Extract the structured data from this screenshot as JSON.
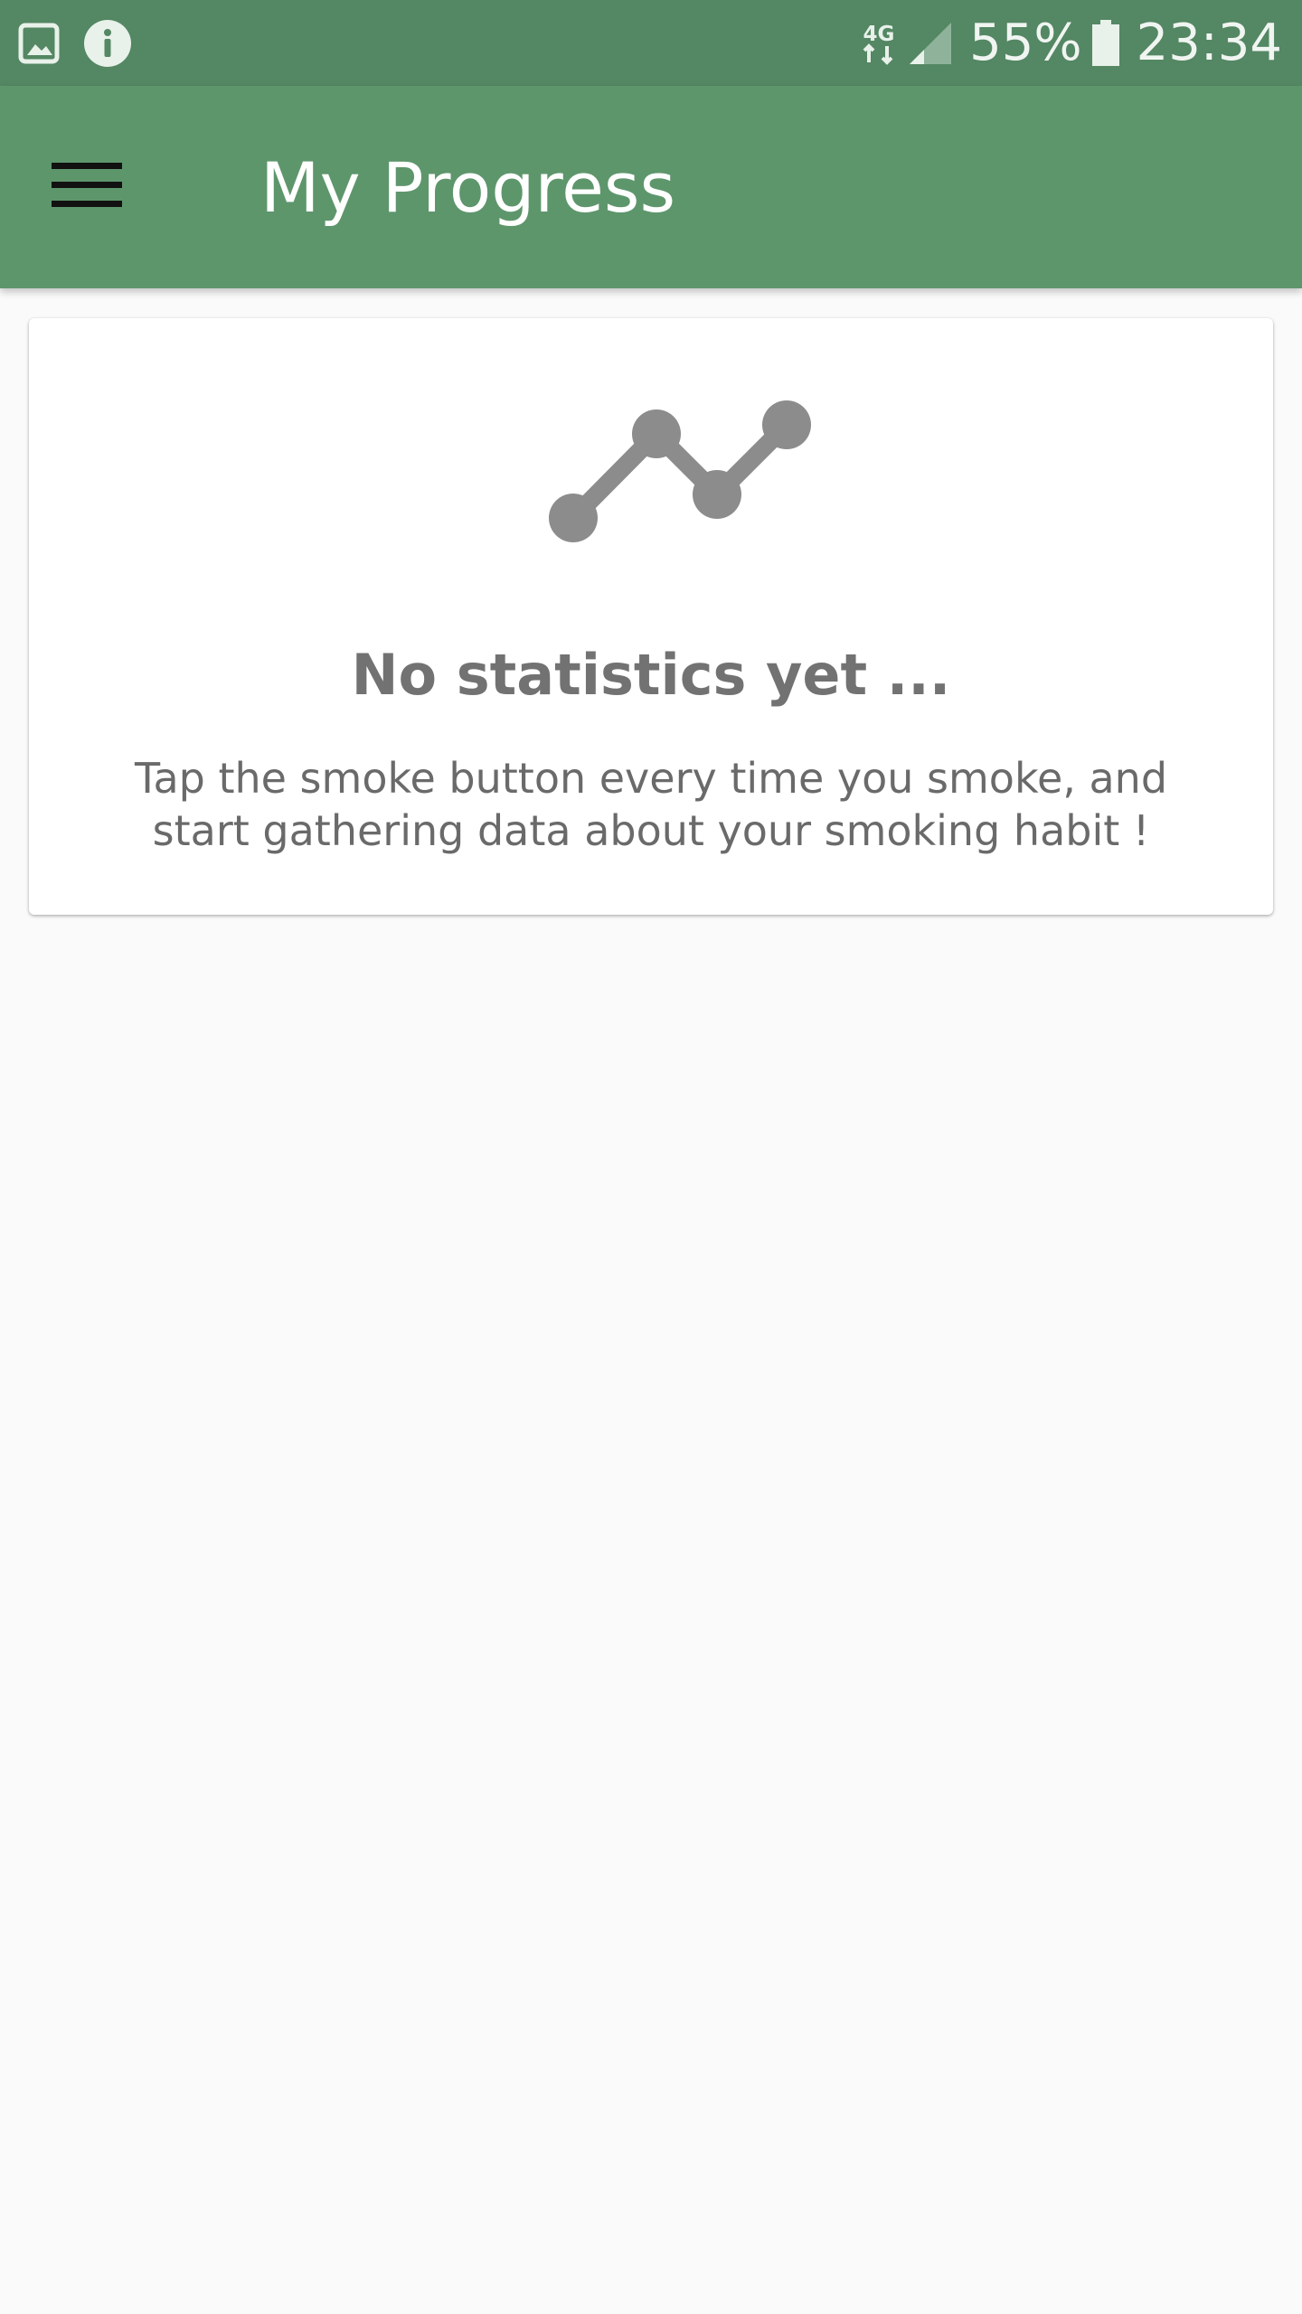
{
  "status_bar": {
    "left_icons": [
      "image-notification-icon",
      "info-notification-icon"
    ],
    "network_label": "4G",
    "battery_percent": "55%",
    "time": "23:34",
    "background_color": "#548763"
  },
  "app_bar": {
    "menu_icon": "hamburger-menu-icon",
    "title": "My Progress",
    "background_color": "#5e966c"
  },
  "empty_state": {
    "icon": "line-chart-icon",
    "title": "No statistics yet ...",
    "message": "Tap the smoke button every time you smoke, and start gathering data about your smoking habit !",
    "icon_color": "#8c8c8c"
  }
}
